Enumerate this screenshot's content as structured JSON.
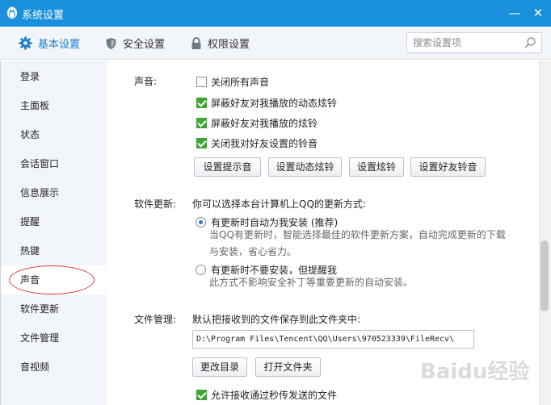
{
  "window": {
    "title": "系统设置",
    "minimize": "—",
    "close": "✕"
  },
  "tabs": [
    {
      "label": "基本设置",
      "icon": "gear-icon",
      "active": true
    },
    {
      "label": "安全设置",
      "icon": "shield-icon",
      "active": false
    },
    {
      "label": "权限设置",
      "icon": "lock-icon",
      "active": false
    }
  ],
  "search": {
    "placeholder": "搜索设置项",
    "value": "",
    "icon": "search-icon"
  },
  "sidebar": {
    "items": [
      {
        "label": "登录"
      },
      {
        "label": "主面板"
      },
      {
        "label": "状态"
      },
      {
        "label": "会话窗口"
      },
      {
        "label": "信息展示"
      },
      {
        "label": "提醒"
      },
      {
        "label": "热键"
      },
      {
        "label": "声音",
        "active": true
      },
      {
        "label": "软件更新"
      },
      {
        "label": "文件管理"
      },
      {
        "label": "音视频"
      }
    ]
  },
  "sound": {
    "label": "声音:",
    "options": [
      {
        "label": "关闭所有声音",
        "checked": false
      },
      {
        "label": "屏蔽好友对我播放的动态炫铃",
        "checked": true
      },
      {
        "label": "屏蔽好友对我播放的炫铃",
        "checked": true
      },
      {
        "label": "关闭我对好友设置的铃音",
        "checked": true
      }
    ],
    "buttons": [
      "设置提示音",
      "设置动态炫铃",
      "设置炫铃",
      "设置好友铃音"
    ]
  },
  "update": {
    "label": "软件更新:",
    "intro": "你可以选择本台计算机上QQ的更新方式:",
    "options": [
      {
        "label": "有更新时自动为我安装 (推荐)",
        "selected": true,
        "desc1": "当QQ有更新时，智能选择最佳的软件更新方案，自动完成更新的下载",
        "desc2": "与安装，省心省力。"
      },
      {
        "label": "有更新时不要安装，但提醒我",
        "selected": false,
        "desc1": "此方式不影响安全补丁等重要更新的自动安装。"
      }
    ]
  },
  "files": {
    "label": "文件管理:",
    "intro": "默认把接收到的文件保存到此文件夹中:",
    "path": "D:\\Program Files\\Tencent\\QQ\\Users\\970523339\\FileRecv\\",
    "buttons": [
      "更改目录",
      "打开文件夹"
    ],
    "allow": {
      "label": "允许接收通过秒传发送的文件",
      "checked": true
    }
  },
  "watermark": "Baidu经验",
  "colors": {
    "titlebar": "#1a90dc",
    "accent": "#1a7fd0",
    "check": "#3fa63a",
    "annotation": "#e23a3a"
  }
}
